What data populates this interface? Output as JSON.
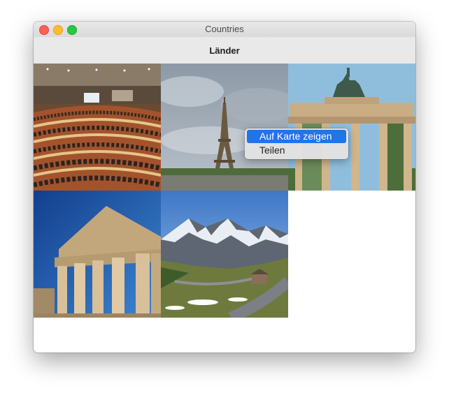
{
  "window": {
    "title": "Countries"
  },
  "navbar": {
    "title": "Länder"
  },
  "photos": [
    {
      "name": "parliament-chamber-photo"
    },
    {
      "name": "eiffel-tower-photo"
    },
    {
      "name": "brandenburg-gate-photo"
    },
    {
      "name": "parthenon-photo"
    },
    {
      "name": "alpine-mountain-road-photo"
    }
  ],
  "context_menu": {
    "items": [
      {
        "label": "Auf Karte zeigen",
        "selected": true
      },
      {
        "label": "Teilen",
        "selected": false
      }
    ]
  },
  "colors": {
    "menu_highlight": "#1f75ea"
  }
}
